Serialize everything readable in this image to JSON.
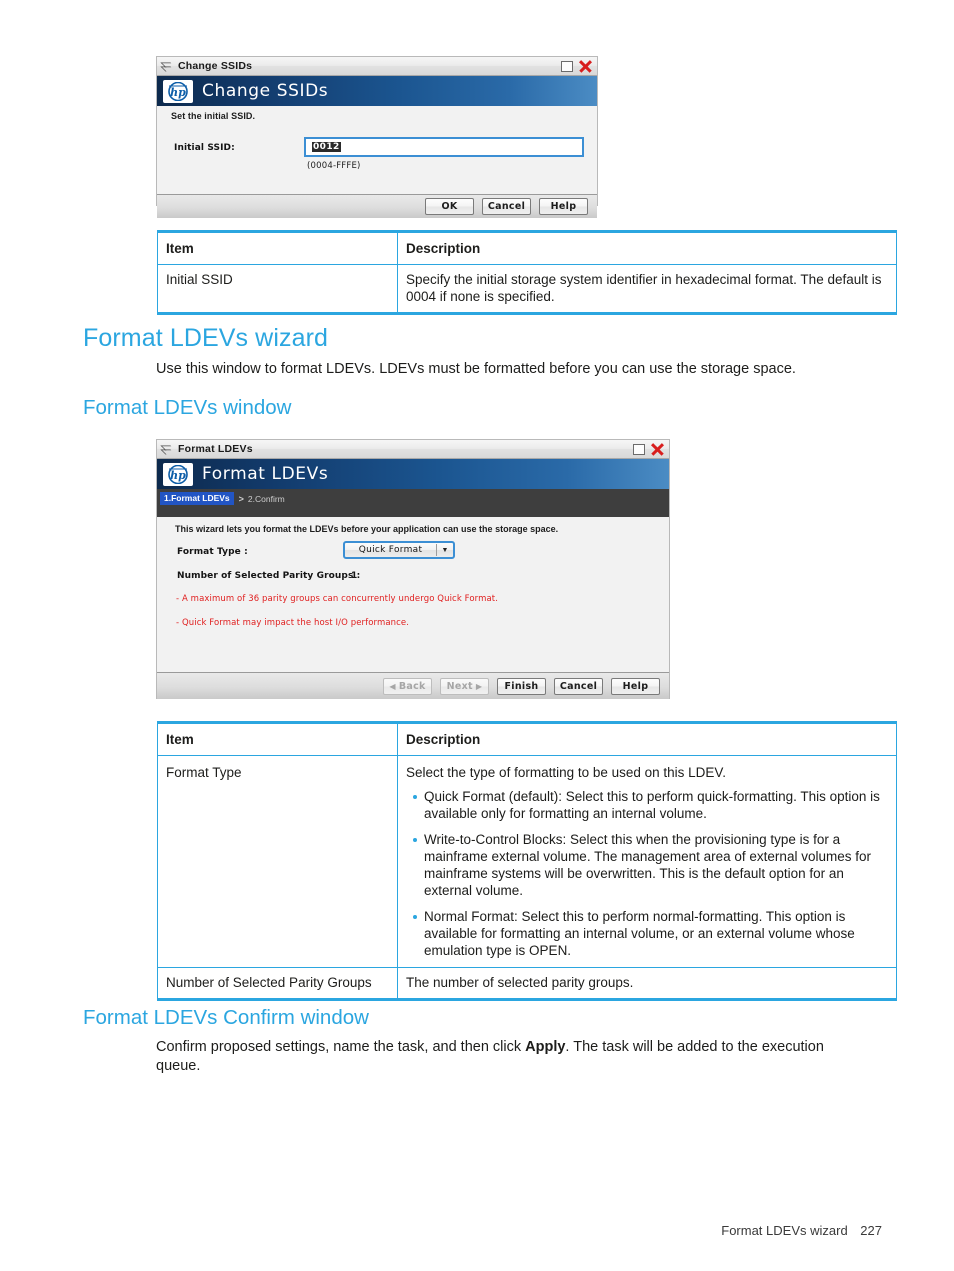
{
  "change_ssids_dialog": {
    "titlebar_title": "Change SSIDs",
    "banner_title": "Change SSIDs",
    "logo": "hp-logo",
    "subtitle": "Set the initial SSID.",
    "field_label": "Initial SSID:",
    "field_value": "0012",
    "field_range_hint": "(0004-FFFE)",
    "buttons": {
      "ok": "OK",
      "cancel": "Cancel",
      "help": "Help"
    }
  },
  "ssid_table": {
    "headers": [
      "Item",
      "Description"
    ],
    "rows": [
      {
        "item": "Initial SSID",
        "description": "Specify the initial storage system identifier in hexadecimal format. The default is 0004 if none is specified."
      }
    ]
  },
  "section_wizard": {
    "heading": "Format LDEVs wizard",
    "paragraph": "Use this window to format LDEVs. LDEVs must be formatted before you can use the storage space."
  },
  "section_window": {
    "heading": "Format LDEVs window"
  },
  "format_ldevs_dialog": {
    "titlebar_title": "Format LDEVs",
    "banner_title": "Format LDEVs",
    "logo": "hp-logo",
    "breadcrumb_active": "1.Format LDEVs",
    "breadcrumb_separator": ">",
    "breadcrumb_next": "2.Confirm",
    "subtitle": "This wizard lets you format the LDEVs before your application can use the storage space.",
    "format_type_label": "Format Type :",
    "format_type_value": "Quick Format",
    "parity_groups_label": "Number of Selected Parity Groups :",
    "parity_groups_value": "1",
    "warnings": [
      "- A maximum of 36 parity groups can concurrently undergo Quick Format.",
      "- Quick Format may impact the host I/O performance."
    ],
    "buttons": {
      "back": "Back",
      "next": "Next",
      "finish": "Finish",
      "cancel": "Cancel",
      "help": "Help"
    }
  },
  "format_table": {
    "headers": [
      "Item",
      "Description"
    ],
    "rows": [
      {
        "item": "Format Type",
        "intro": "Select the type of formatting to be used on this LDEV.",
        "bullets": [
          "Quick Format (default): Select this to perform quick-formatting. This option is available only for formatting an internal volume.",
          "Write-to-Control Blocks: Select this when the provisioning type is for a mainframe external volume. The management area of external volumes for mainframe systems will be overwritten. This is the default option for an external volume.",
          "Normal Format: Select this to perform normal-formatting. This option is available for formatting an internal volume, or an external volume whose emulation type is OPEN."
        ]
      },
      {
        "item": "Number of Selected Parity Groups",
        "intro": "The number of selected parity groups.",
        "bullets": []
      }
    ]
  },
  "section_confirm": {
    "heading": "Format LDEVs Confirm window",
    "paragraph_before": "Confirm proposed settings, name the task, and then click ",
    "paragraph_bold": "Apply",
    "paragraph_after": ". The task will be added to the execution queue."
  },
  "page_footer": {
    "label": "Format LDEVs wizard",
    "page_number": "227"
  },
  "colors": {
    "accent": "#2ba6e0",
    "heading": "#2ba6e0",
    "warning": "#e02020",
    "banner_dark": "#0d2a4d",
    "crumb_active": "#2255c4"
  }
}
